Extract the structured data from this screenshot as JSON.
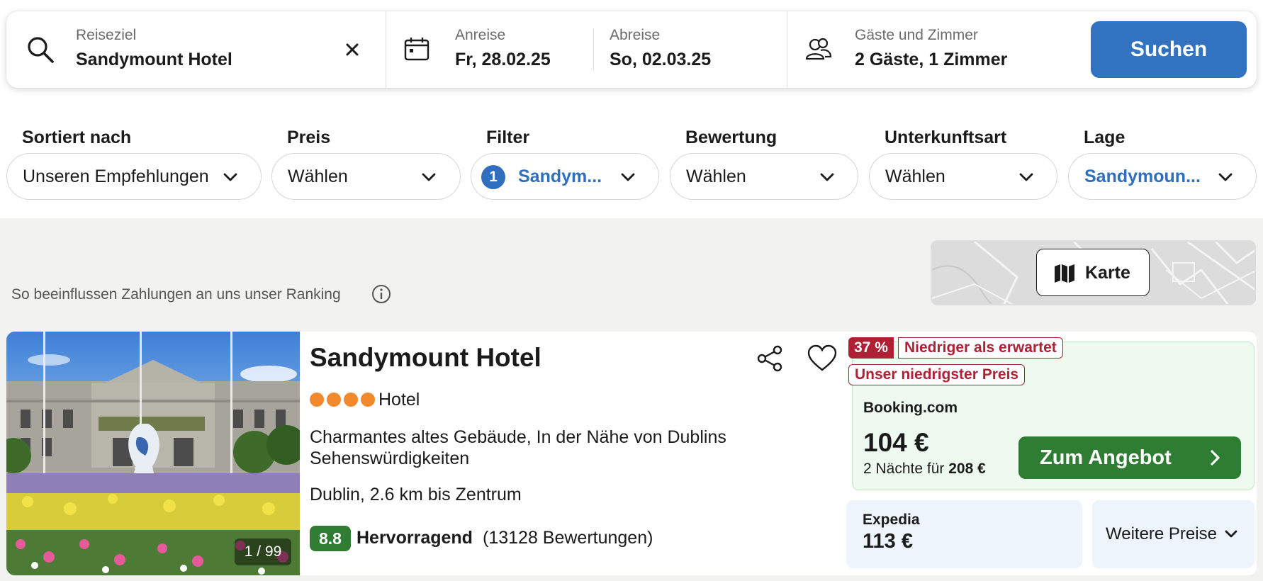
{
  "search": {
    "destination_label": "Reiseziel",
    "destination_value": "Sandymount Hotel",
    "checkin_label": "Anreise",
    "checkin_value": "Fr, 28.02.25",
    "checkout_label": "Abreise",
    "checkout_value": "So, 02.03.25",
    "guests_label": "Gäste und Zimmer",
    "guests_value": "2 Gäste, 1 Zimmer",
    "search_button": "Suchen"
  },
  "filters": [
    {
      "title": "Sortiert nach",
      "value": "Unseren Empfehlungen"
    },
    {
      "title": "Preis",
      "value": "Wählen"
    },
    {
      "title": "Filter",
      "value": "Sandym...",
      "count": "1"
    },
    {
      "title": "Bewertung",
      "value": "Wählen"
    },
    {
      "title": "Unterkunftsart",
      "value": "Wählen"
    },
    {
      "title": "Lage",
      "value": "Sandymoun..."
    }
  ],
  "ranking_note": "So beeinflussen Zahlungen an uns unser Ranking",
  "map_button": "Karte",
  "result": {
    "photo_count": "1 / 99",
    "name": "Sandymount Hotel",
    "star_count": 4,
    "type": "Hotel",
    "description": "Charmantes altes Gebäude, In der Nähe von Dublins Sehenswürdigkeiten",
    "location": "Dublin, 2.6 km bis Zentrum",
    "rating_score": "8.8",
    "rating_word": "Hervorragend",
    "rating_count": "(13128 Bewertungen)",
    "deal": {
      "discount": "37 %",
      "discount_label": "Niedriger als erwartet",
      "best_label": "Unser niedrigster Preis",
      "provider": "Booking.com",
      "price": "104 €",
      "nights_text": "2 Nächte für",
      "total": "208 €",
      "button": "Zum Angebot"
    },
    "alternate": {
      "provider": "Expedia",
      "price": "113 €"
    },
    "more_prices": "Weitere Preise"
  },
  "colors": {
    "accent_blue": "#3173c1",
    "deal_green": "#2e7d32",
    "discount_red": "#b02035",
    "star_orange": "#f08a2c"
  }
}
